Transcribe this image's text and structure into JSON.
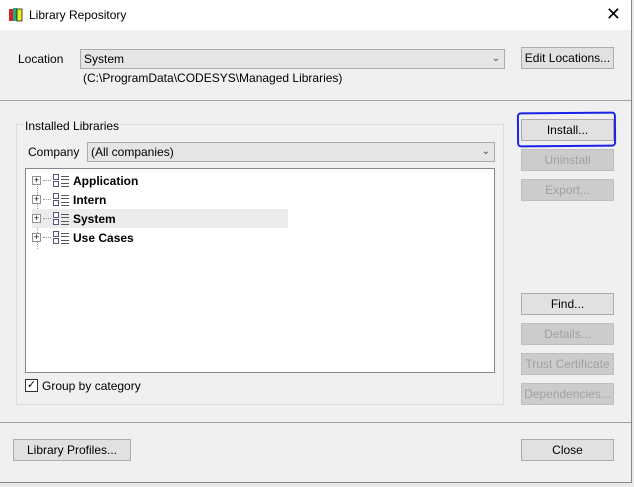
{
  "window": {
    "title": "Library Repository",
    "close": "✕"
  },
  "location": {
    "label": "Location",
    "value": "System",
    "path": "(C:\\ProgramData\\CODESYS\\Managed Libraries)",
    "edit_button": "Edit Locations..."
  },
  "installed": {
    "group_label": "Installed Libraries",
    "company_label": "Company",
    "company_value": "(All companies)",
    "tree": [
      {
        "label": "Application"
      },
      {
        "label": "Intern"
      },
      {
        "label": "System"
      },
      {
        "label": "Use Cases"
      }
    ],
    "group_by_category": {
      "label": "Group by category",
      "checked": true
    }
  },
  "buttons": {
    "install": "Install...",
    "uninstall": "Uninstall",
    "export": "Export...",
    "find": "Find...",
    "details": "Details...",
    "trust": "Trust Certificate",
    "dependencies": "Dependencies...",
    "library_profiles": "Library Profiles...",
    "close": "Close"
  }
}
